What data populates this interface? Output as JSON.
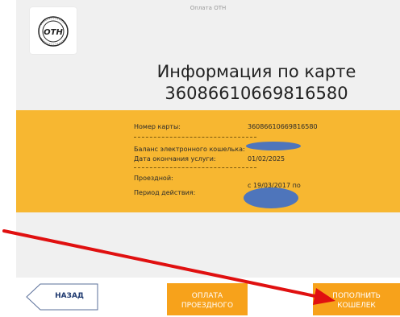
{
  "header": {
    "title": "Оплата ОТН"
  },
  "logo": {
    "text": "ОТН",
    "ring_text": "ОБЪЕДИНЕННЫЙ ТРАНСПОРТНЫЙ НОВОСИБИРСКА"
  },
  "card_info": {
    "heading_line1": "Информация по карте",
    "heading_line2": "36086610669816580",
    "card_number_label": "Номер карты:",
    "card_number_value": "36086610669816580",
    "balance_label": "Баланс электронного кошелька:",
    "end_date_label": "Дата окончания услуги:",
    "end_date_value": "01/02/2025",
    "pass_label": "Проездной:",
    "period_label": "Период действия:",
    "period_value": "с 19/03/2017 по"
  },
  "buttons": {
    "back": "НАЗАД",
    "pay_line1": "ОПЛАТА",
    "pay_line2": "ПРОЕЗДНОГО",
    "topup_line1": "ПОПОЛНИТЬ",
    "topup_line2": "КОШЕЛЕК"
  },
  "colors": {
    "accent": "#f7b731",
    "button": "#f7a21b",
    "arrow": "#e01010",
    "redaction": "#3f6fc7"
  }
}
